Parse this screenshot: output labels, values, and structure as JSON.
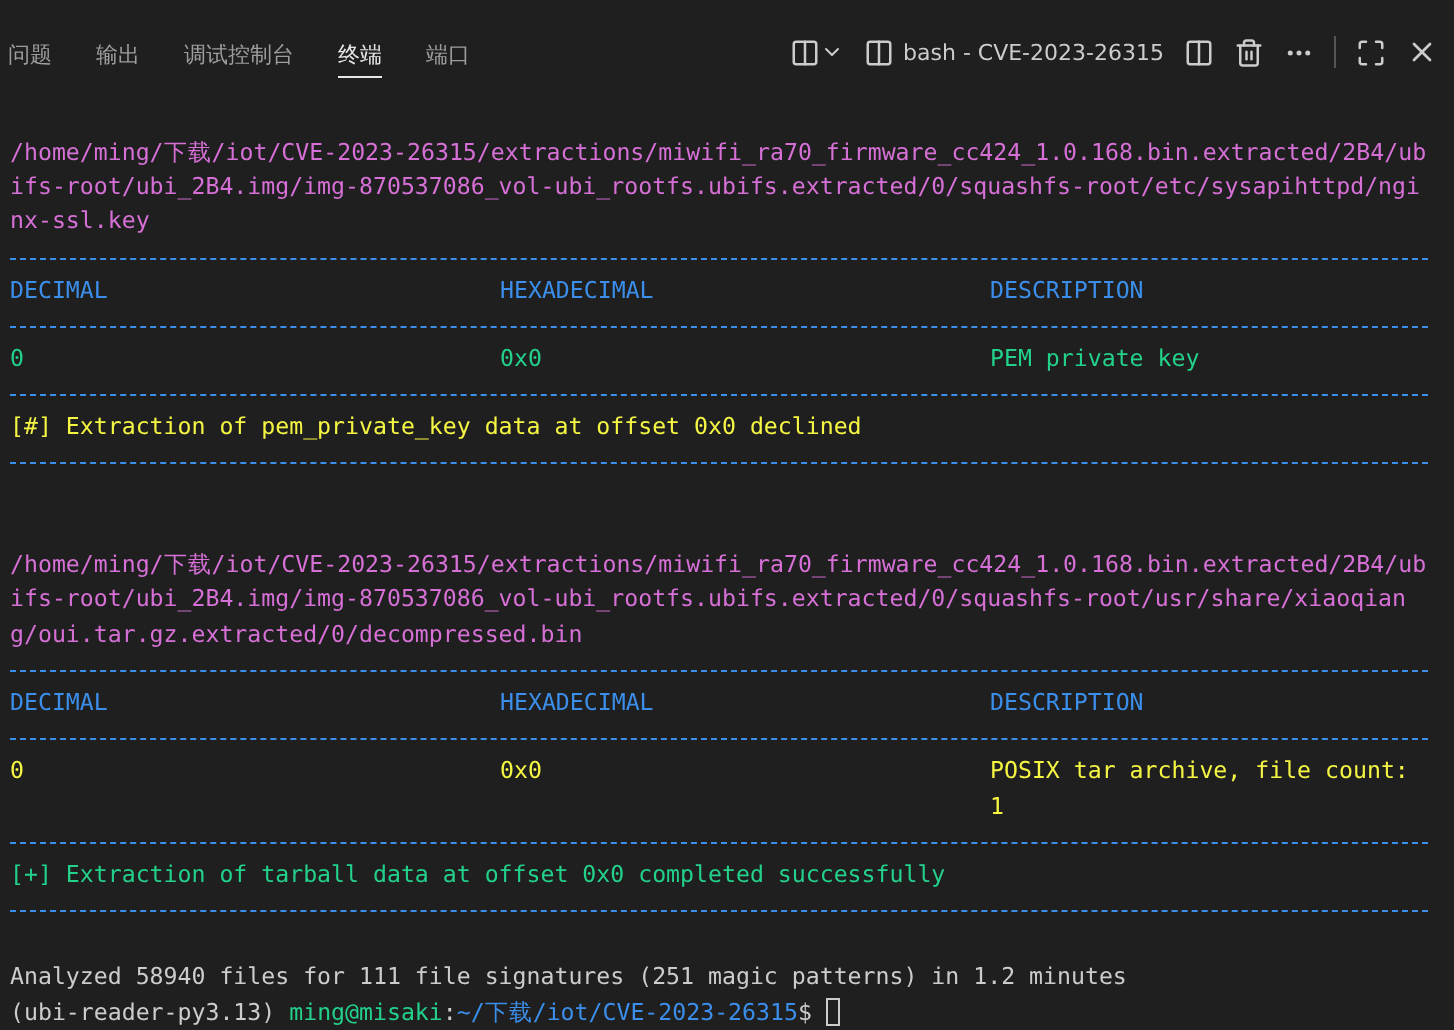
{
  "panel": {
    "tabs": [
      {
        "label": "问题",
        "selected": false
      },
      {
        "label": "输出",
        "selected": false
      },
      {
        "label": "调试控制台",
        "selected": false
      },
      {
        "label": "终端",
        "selected": true
      },
      {
        "label": "端口",
        "selected": false
      }
    ],
    "terminal_name": "bash - CVE-2023-26315"
  },
  "terminal": {
    "lines": [
      {
        "kind": "blank"
      },
      {
        "kind": "text",
        "color": "#d670d6",
        "text": "/home/ming/下载/iot/CVE-2023-26315/extractions/miwifi_ra70_firmware_cc424_1.0.168.bin.extracted/2B4/ubifs-root/ubi_2B4.img/img-870537086_vol-ubi_rootfs.ubifs.extracted/0/squashfs-root/etc/sysapihttpd/nginx-ssl.key"
      },
      {
        "kind": "rule",
        "color": "#3b8eea"
      },
      {
        "kind": "columns",
        "color": "#3b8eea",
        "cells": [
          "DECIMAL",
          "HEXADECIMAL",
          "DESCRIPTION"
        ]
      },
      {
        "kind": "rule",
        "color": "#3b8eea"
      },
      {
        "kind": "columns",
        "color": "#23d18b",
        "cells": [
          "0",
          "0x0",
          "PEM private key"
        ]
      },
      {
        "kind": "rule",
        "color": "#3b8eea"
      },
      {
        "kind": "text",
        "color": "#f5f543",
        "text": "[#] Extraction of pem_private_key data at offset 0x0 declined"
      },
      {
        "kind": "rule",
        "color": "#3b8eea"
      },
      {
        "kind": "blank"
      },
      {
        "kind": "blank"
      },
      {
        "kind": "text",
        "color": "#d670d6",
        "text": "/home/ming/下载/iot/CVE-2023-26315/extractions/miwifi_ra70_firmware_cc424_1.0.168.bin.extracted/2B4/ubifs-root/ubi_2B4.img/img-870537086_vol-ubi_rootfs.ubifs.extracted/0/squashfs-root/usr/share/xiaoqiang/oui.tar.gz.extracted/0/decompressed.bin"
      },
      {
        "kind": "rule",
        "color": "#3b8eea"
      },
      {
        "kind": "columns",
        "color": "#3b8eea",
        "cells": [
          "DECIMAL",
          "HEXADECIMAL",
          "DESCRIPTION"
        ]
      },
      {
        "kind": "rule",
        "color": "#3b8eea"
      },
      {
        "kind": "columns",
        "color": "#f5f543",
        "cells": [
          "0",
          "0x0",
          "POSIX tar archive, file count: 1"
        ]
      },
      {
        "kind": "rule",
        "color": "#3b8eea"
      },
      {
        "kind": "text",
        "color": "#23d18b",
        "text": "[+] Extraction of tarball data at offset 0x0 completed successfully"
      },
      {
        "kind": "rule",
        "color": "#3b8eea"
      },
      {
        "kind": "blank"
      },
      {
        "kind": "text",
        "color": "#cccccc",
        "text": "Analyzed 58940 files for 111 file signatures (251 magic patterns) in 1.2 minutes"
      },
      {
        "kind": "prompt",
        "parts": [
          {
            "text": "(ubi-reader-py3.13) ",
            "color": "#cccccc"
          },
          {
            "text": "ming@misaki",
            "color": "#23d18b"
          },
          {
            "text": ":",
            "color": "#cccccc"
          },
          {
            "text": "~/下载/iot/CVE-2023-26315",
            "color": "#3b8eea"
          },
          {
            "text": "$",
            "color": "#cccccc"
          }
        ]
      }
    ]
  }
}
